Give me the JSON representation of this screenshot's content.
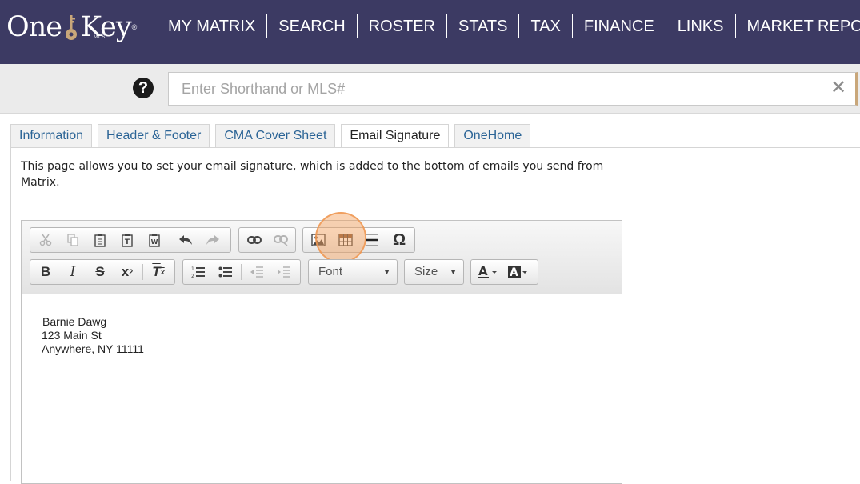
{
  "header": {
    "logo_text_left": "One",
    "logo_text_right": "Key",
    "logo_sub": "MLS",
    "logo_tm": "®",
    "nav": [
      "MY MATRIX",
      "SEARCH",
      "ROSTER",
      "STATS",
      "TAX",
      "FINANCE",
      "LINKS",
      "MARKET REPORTS"
    ]
  },
  "search": {
    "help_glyph": "?",
    "placeholder": "Enter Shorthand or MLS#",
    "value": "",
    "clear_glyph": "✕"
  },
  "tabs": [
    {
      "label": "Information",
      "active": false
    },
    {
      "label": "Header & Footer",
      "active": false
    },
    {
      "label": "CMA Cover Sheet",
      "active": false
    },
    {
      "label": "Email Signature",
      "active": true
    },
    {
      "label": "OneHome",
      "active": false
    }
  ],
  "description": "This page allows you to set your email signature, which is added to the bottom of emails you send from Matrix.",
  "editor": {
    "font_label": "Font",
    "size_label": "Size",
    "highlighted_button": "image-icon",
    "lines": [
      "Barnie Dawg",
      "123 Main St",
      "Anywhere, NY 11111"
    ]
  },
  "colors": {
    "header_bg": "#3c3a63",
    "tab_link": "#2b6496",
    "highlight": "#f4a05c"
  }
}
